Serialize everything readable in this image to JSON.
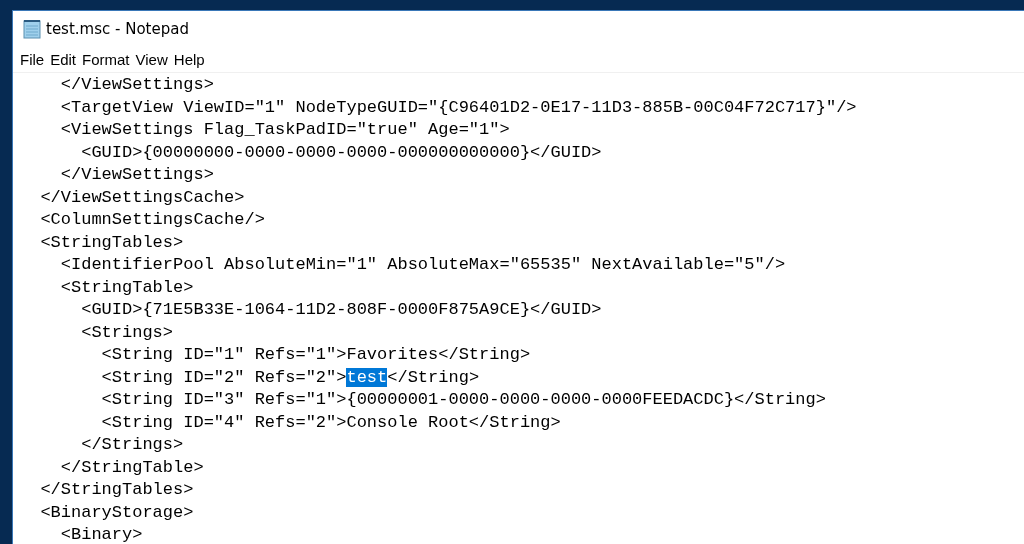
{
  "window": {
    "title": "test.msc - Notepad"
  },
  "menu": [
    "File",
    "Edit",
    "Format",
    "View",
    "Help"
  ],
  "editor": {
    "lines": [
      {
        "segments": [
          {
            "text": "    </ViewSettings>",
            "selected": false
          }
        ]
      },
      {
        "segments": [
          {
            "text": "    <TargetView ViewID=\"1\" NodeTypeGUID=\"{C96401D2-0E17-11D3-885B-00C04F72C717}\"/>",
            "selected": false
          }
        ]
      },
      {
        "segments": [
          {
            "text": "    <ViewSettings Flag_TaskPadID=\"true\" Age=\"1\">",
            "selected": false
          }
        ]
      },
      {
        "segments": [
          {
            "text": "      <GUID>{00000000-0000-0000-0000-000000000000}</GUID>",
            "selected": false
          }
        ]
      },
      {
        "segments": [
          {
            "text": "    </ViewSettings>",
            "selected": false
          }
        ]
      },
      {
        "segments": [
          {
            "text": "  </ViewSettingsCache>",
            "selected": false
          }
        ]
      },
      {
        "segments": [
          {
            "text": "  <ColumnSettingsCache/>",
            "selected": false
          }
        ]
      },
      {
        "segments": [
          {
            "text": "  <StringTables>",
            "selected": false
          }
        ]
      },
      {
        "segments": [
          {
            "text": "    <IdentifierPool AbsoluteMin=\"1\" AbsoluteMax=\"65535\" NextAvailable=\"5\"/>",
            "selected": false
          }
        ]
      },
      {
        "segments": [
          {
            "text": "    <StringTable>",
            "selected": false
          }
        ]
      },
      {
        "segments": [
          {
            "text": "      <GUID>{71E5B33E-1064-11D2-808F-0000F875A9CE}</GUID>",
            "selected": false
          }
        ]
      },
      {
        "segments": [
          {
            "text": "      <Strings>",
            "selected": false
          }
        ]
      },
      {
        "segments": [
          {
            "text": "        <String ID=\"1\" Refs=\"1\">Favorites</String>",
            "selected": false
          }
        ]
      },
      {
        "segments": [
          {
            "text": "        <String ID=\"2\" Refs=\"2\">",
            "selected": false
          },
          {
            "text": "test",
            "selected": true
          },
          {
            "text": "</String>",
            "selected": false
          }
        ]
      },
      {
        "segments": [
          {
            "text": "        <String ID=\"3\" Refs=\"1\">{00000001-0000-0000-0000-0000FEEDACDC}</String>",
            "selected": false
          }
        ]
      },
      {
        "segments": [
          {
            "text": "        <String ID=\"4\" Refs=\"2\">Console Root</String>",
            "selected": false
          }
        ]
      },
      {
        "segments": [
          {
            "text": "      </Strings>",
            "selected": false
          }
        ]
      },
      {
        "segments": [
          {
            "text": "    </StringTable>",
            "selected": false
          }
        ]
      },
      {
        "segments": [
          {
            "text": "  </StringTables>",
            "selected": false
          }
        ]
      },
      {
        "segments": [
          {
            "text": "  <BinaryStorage>",
            "selected": false
          }
        ]
      },
      {
        "segments": [
          {
            "text": "    <Binary>",
            "selected": false
          }
        ]
      }
    ]
  }
}
